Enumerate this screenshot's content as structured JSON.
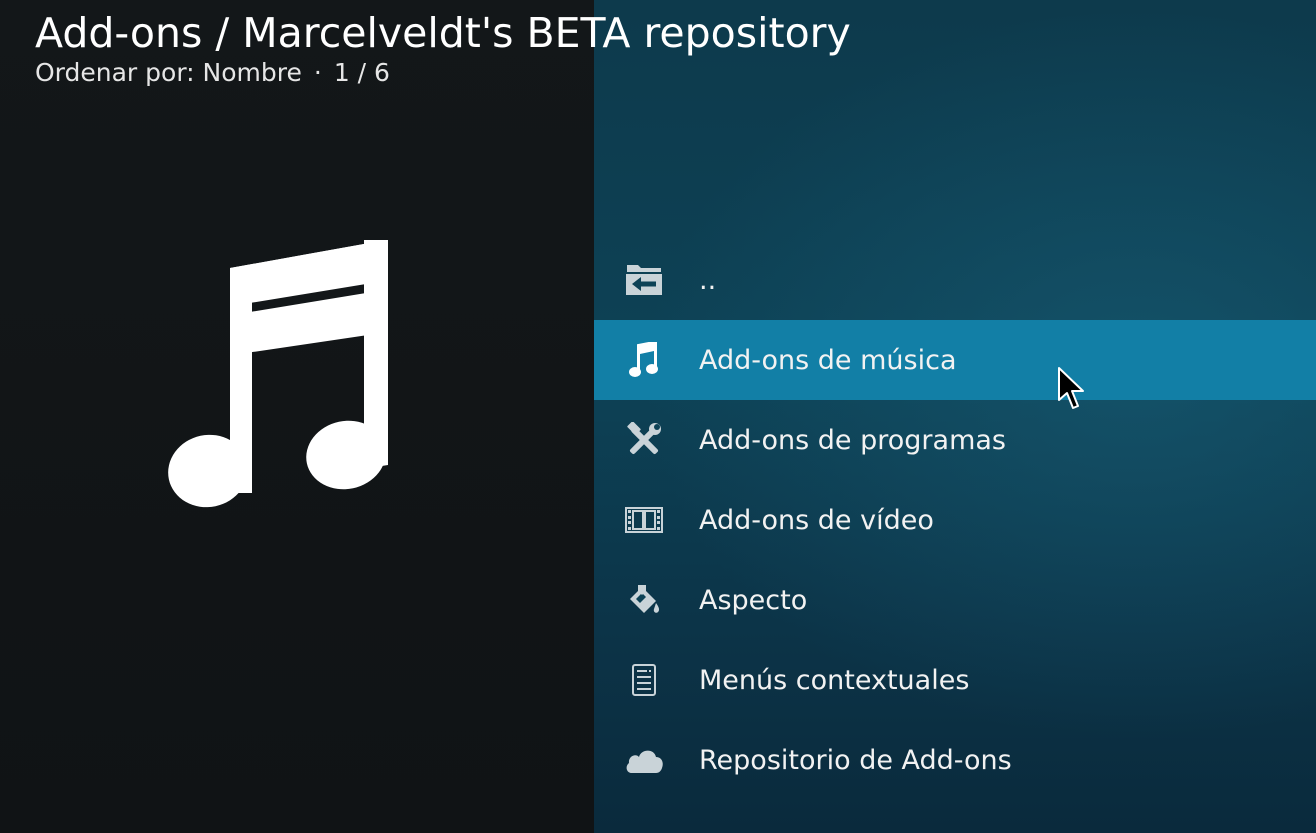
{
  "header": {
    "title": "Add-ons / Marcelveldt's BETA repository",
    "sort_label": "Ordenar por: Nombre",
    "separator": "·",
    "page_counter": "1 / 6"
  },
  "preview": {
    "icon": "music-note-icon"
  },
  "list": {
    "items": [
      {
        "label": "..",
        "icon": "folder-back-icon",
        "selected": false
      },
      {
        "label": "Add-ons de música",
        "icon": "music-note-icon",
        "selected": true
      },
      {
        "label": "Add-ons de programas",
        "icon": "tools-icon",
        "selected": false
      },
      {
        "label": "Add-ons de vídeo",
        "icon": "film-strip-icon",
        "selected": false
      },
      {
        "label": "Aspecto",
        "icon": "paint-bucket-icon",
        "selected": false
      },
      {
        "label": "Menús contextuales",
        "icon": "context-menu-icon",
        "selected": false
      },
      {
        "label": "Repositorio de Add-ons",
        "icon": "cloud-icon",
        "selected": false
      }
    ]
  },
  "colors": {
    "left_background": "#131719",
    "right_background": "#0d4256",
    "selection": "#127fa6"
  }
}
